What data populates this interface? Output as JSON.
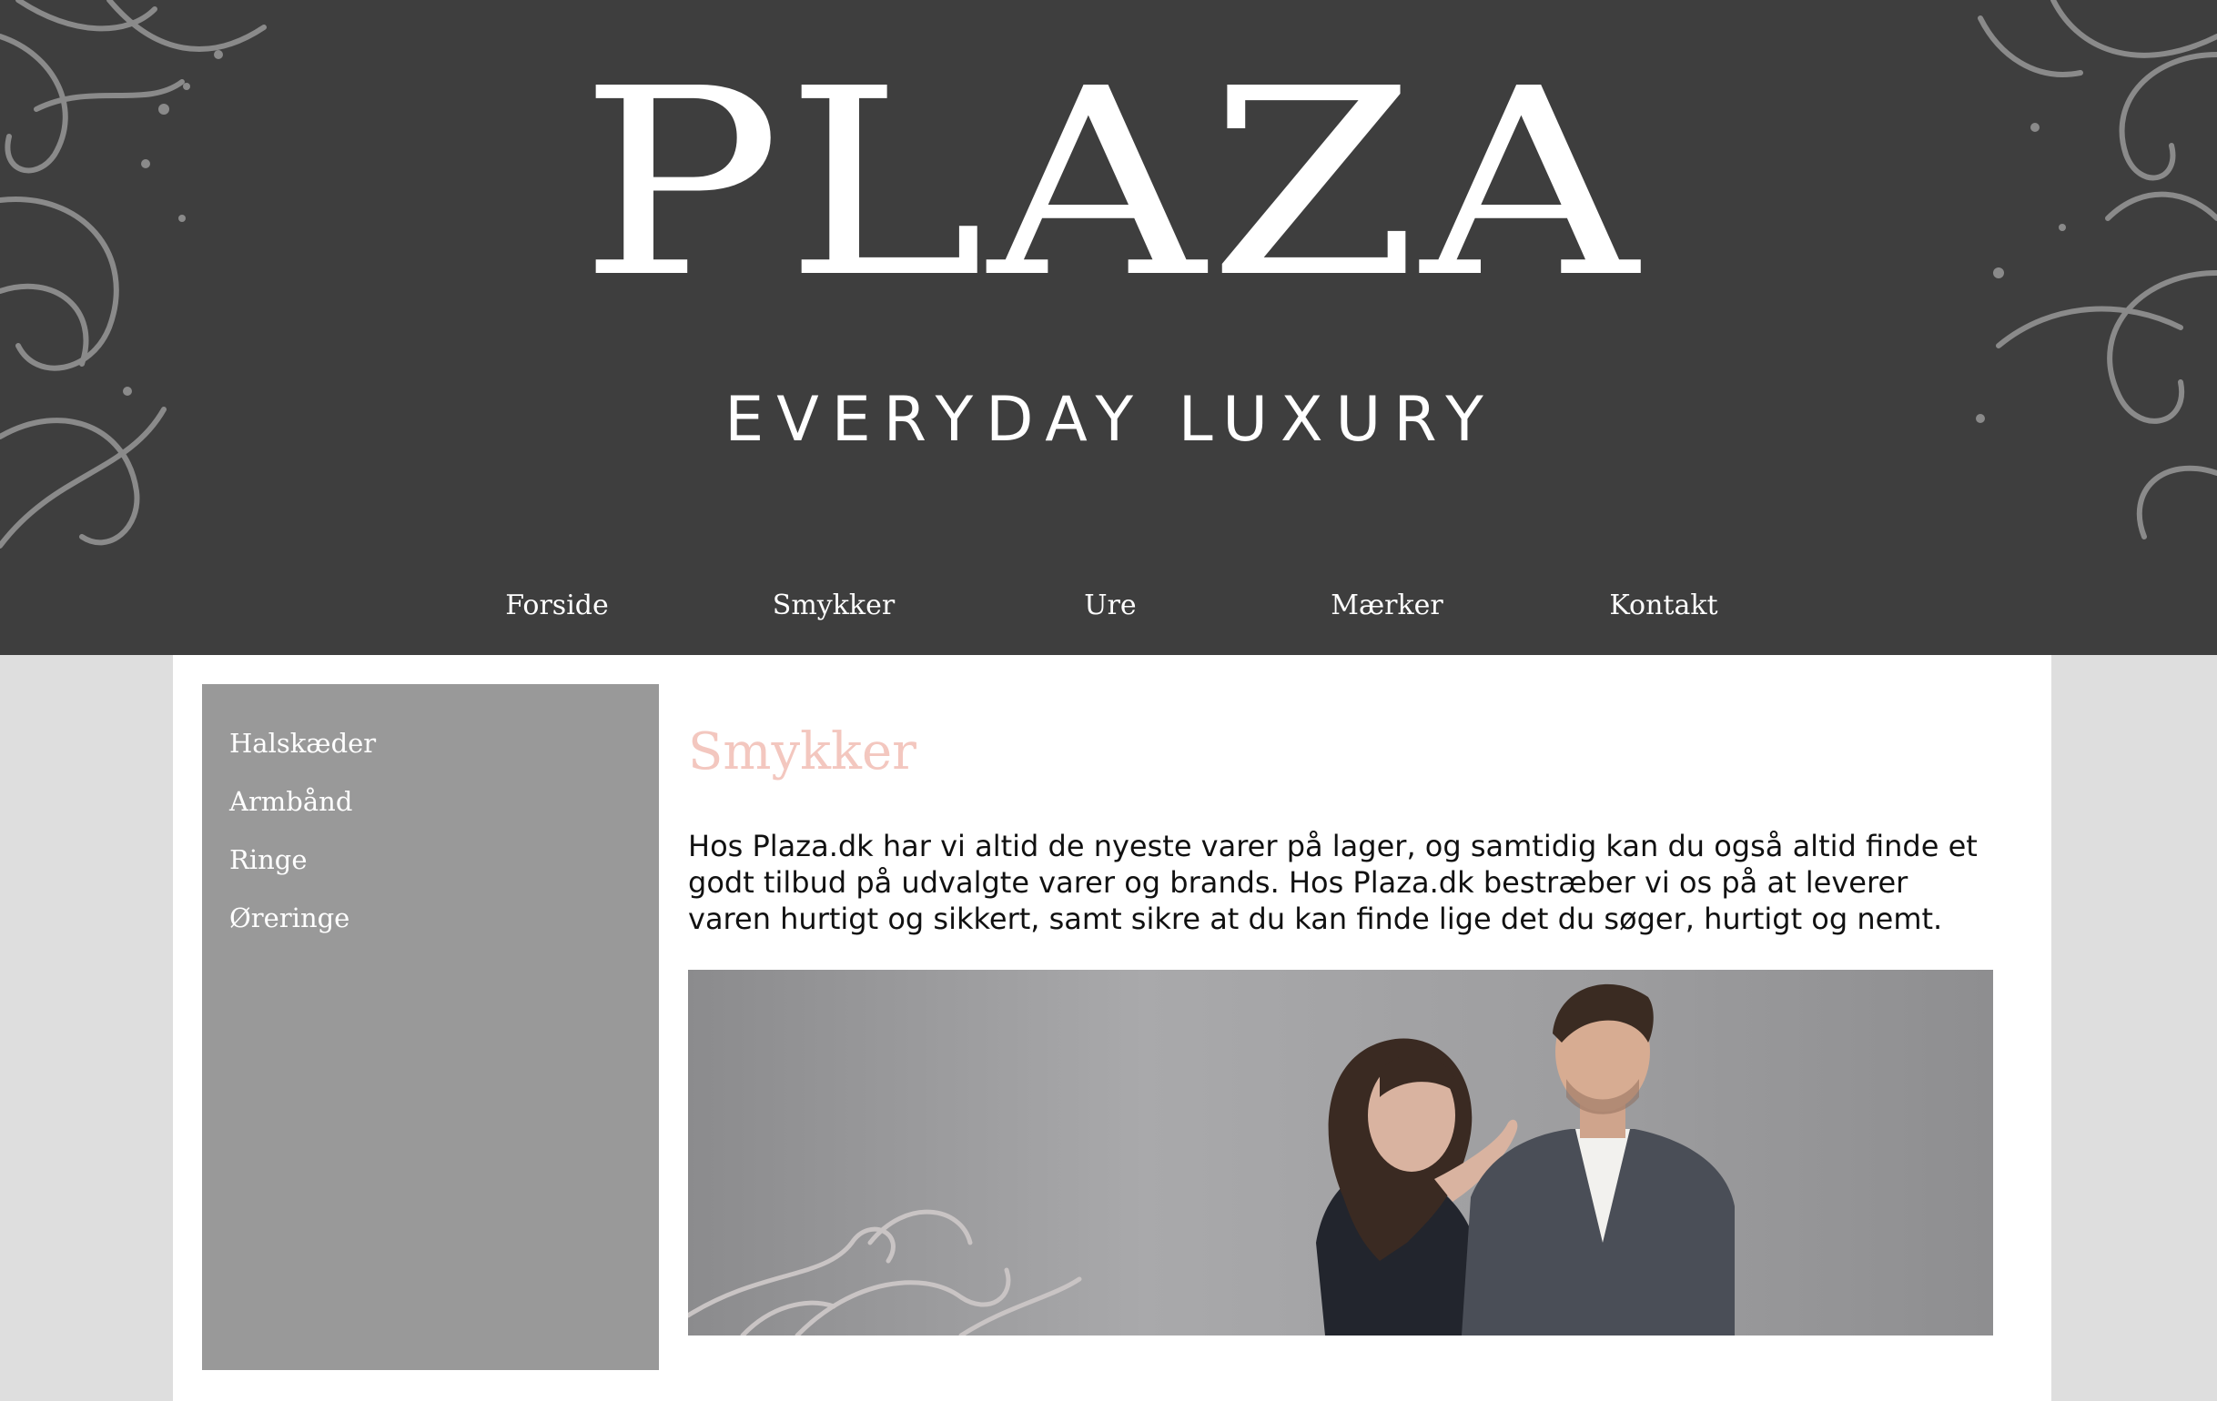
{
  "brand": {
    "name": "PLAZA",
    "tagline": "EVERYDAY LUXURY"
  },
  "topnav": {
    "items": [
      {
        "label": "Forside"
      },
      {
        "label": "Smykker"
      },
      {
        "label": "Ure"
      },
      {
        "label": "Mærker"
      },
      {
        "label": "Kontakt"
      }
    ]
  },
  "sidebar": {
    "items": [
      {
        "label": "Halskæder"
      },
      {
        "label": "Armbånd"
      },
      {
        "label": "Ringe"
      },
      {
        "label": "Øreringe"
      }
    ]
  },
  "main": {
    "title": "Smykker",
    "intro": "Hos Plaza.dk har vi altid de nyeste varer på lager, og samtidig kan du også altid finde et godt tilbud på udvalgte varer og brands. Hos Plaza.dk bestræber vi os på at leverer varen hurtigt og sikkert, samt sikre at du kan finde lige det du søger, hurtigt og nemt.",
    "hero_image": "couple-photo"
  },
  "colors": {
    "header_bg": "#3e3e3e",
    "page_bg": "#dedede",
    "sidebar_bg": "#999999",
    "title_color": "#f3c7bf",
    "text_color": "#111111"
  }
}
